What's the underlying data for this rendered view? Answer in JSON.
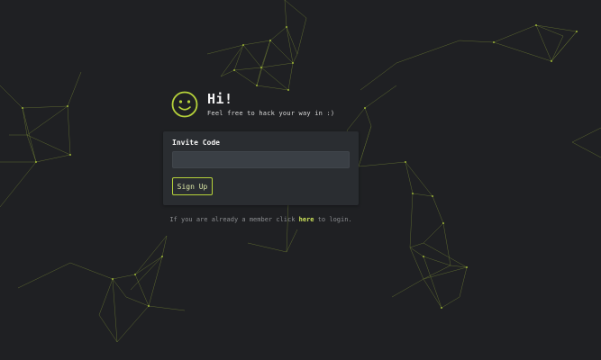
{
  "header": {
    "title": "Hi!",
    "subtitle": "Feel free to hack your way in :)"
  },
  "form": {
    "field_label": "Invite Code",
    "field_value": "",
    "field_placeholder": "",
    "submit_label": "Sign Up"
  },
  "footer": {
    "prefix": "If you are already a member click",
    "link_label": "here",
    "suffix": "to login."
  },
  "colors": {
    "background": "#1f2023",
    "accent": "#b6d23a",
    "card": "#2a2d31",
    "input": "#3a3f45"
  },
  "icons": {
    "avatar": "smiley-face-icon"
  }
}
